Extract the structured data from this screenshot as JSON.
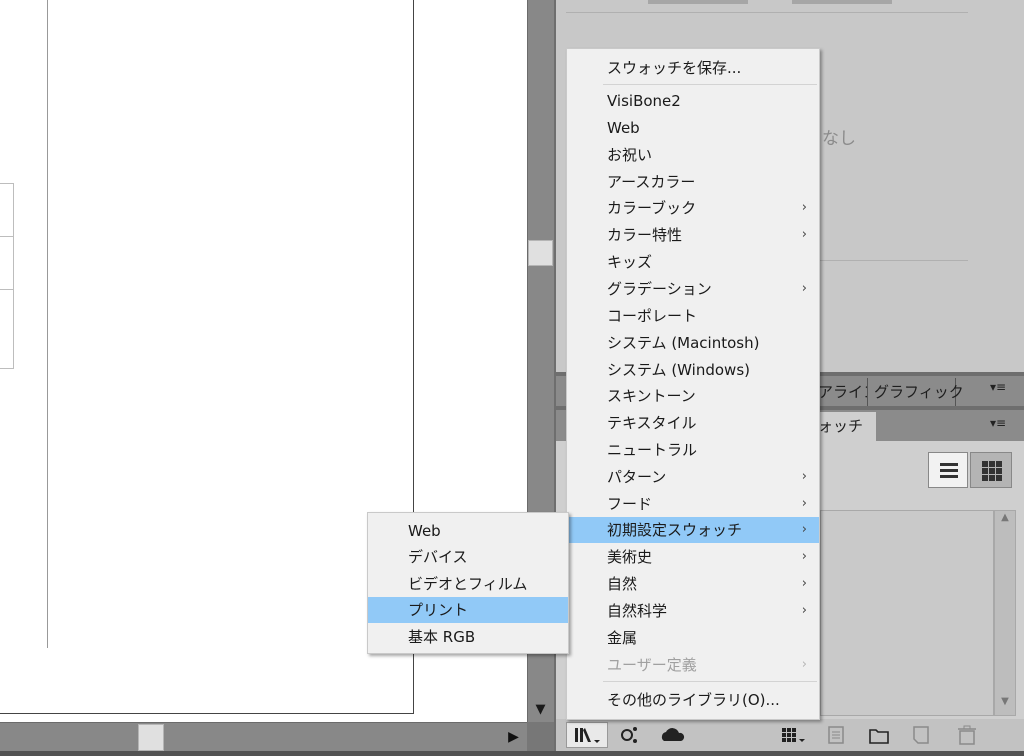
{
  "swatch_panel": {
    "empty_label": "なし",
    "tabs": [
      "アラインメント",
      "グラフィック",
      "スウォッチ"
    ],
    "tab_align_label": "アライン",
    "tab_graphic_label": "グラフィック",
    "tab_swatch_label": "ォッチ",
    "panel_menu_icon": "▾≡"
  },
  "swatch_menu": {
    "save_label": "スウォッチを保存...",
    "items": [
      {
        "label": "VisiBone2",
        "submenu": false,
        "enabled": true
      },
      {
        "label": "Web",
        "submenu": false,
        "enabled": true
      },
      {
        "label": "お祝い",
        "submenu": false,
        "enabled": true
      },
      {
        "label": "アースカラー",
        "submenu": false,
        "enabled": true
      },
      {
        "label": "カラーブック",
        "submenu": true,
        "enabled": true
      },
      {
        "label": "カラー特性",
        "submenu": true,
        "enabled": true
      },
      {
        "label": "キッズ",
        "submenu": false,
        "enabled": true
      },
      {
        "label": "グラデーション",
        "submenu": true,
        "enabled": true
      },
      {
        "label": "コーポレート",
        "submenu": false,
        "enabled": true
      },
      {
        "label": "システム (Macintosh)",
        "submenu": false,
        "enabled": true
      },
      {
        "label": "システム (Windows)",
        "submenu": false,
        "enabled": true
      },
      {
        "label": "スキントーン",
        "submenu": false,
        "enabled": true
      },
      {
        "label": "テキスタイル",
        "submenu": false,
        "enabled": true
      },
      {
        "label": "ニュートラル",
        "submenu": false,
        "enabled": true
      },
      {
        "label": "パターン",
        "submenu": true,
        "enabled": true
      },
      {
        "label": "フード",
        "submenu": true,
        "enabled": true
      },
      {
        "label": "初期設定スウォッチ",
        "submenu": true,
        "enabled": true,
        "highlighted": true
      },
      {
        "label": "美術史",
        "submenu": true,
        "enabled": true
      },
      {
        "label": "自然",
        "submenu": true,
        "enabled": true
      },
      {
        "label": "自然科学",
        "submenu": true,
        "enabled": true
      },
      {
        "label": "金属",
        "submenu": false,
        "enabled": true
      },
      {
        "label": "ユーザー定義",
        "submenu": true,
        "enabled": false
      }
    ],
    "other_library_label": "その他のライブラリ(O)..."
  },
  "submenu": {
    "items": [
      {
        "label": "Web"
      },
      {
        "label": "デバイス"
      },
      {
        "label": "ビデオとフィルム"
      },
      {
        "label": "プリント",
        "highlighted": true
      },
      {
        "label": "基本 RGB"
      }
    ]
  },
  "icons": {
    "submenu_arrow": "›",
    "scroll_down": "▼",
    "scroll_right": "▶",
    "scroll_up_small": "▲",
    "scroll_down_small": "▼",
    "library": "library-icon",
    "share": "share-icon",
    "cloud": "cloud-icon",
    "grid_menu": "swatch-kind-icon",
    "doc": "swatch-options-icon",
    "folder": "new-group-icon",
    "new_swatch": "new-swatch-icon",
    "trash": "trash-icon"
  },
  "colors": {
    "highlight": "#91c9f7",
    "menu_bg": "#f0f0f0",
    "panel_bg": "#cfcfcf"
  }
}
